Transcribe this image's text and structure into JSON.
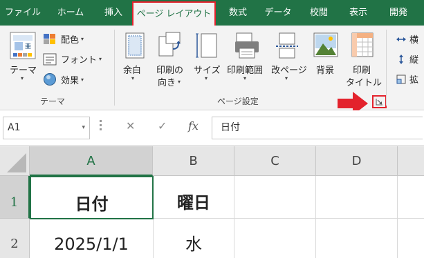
{
  "tabs": [
    {
      "label": "ファイル",
      "active": false
    },
    {
      "label": "ホーム",
      "active": false
    },
    {
      "label": "挿入",
      "active": false
    },
    {
      "label": "ページ レイアウト",
      "active": true
    },
    {
      "label": "数式",
      "active": false
    },
    {
      "label": "データ",
      "active": false
    },
    {
      "label": "校閲",
      "active": false
    },
    {
      "label": "表示",
      "active": false
    },
    {
      "label": "開発",
      "active": false
    }
  ],
  "ribbon": {
    "theme_group": {
      "theme_label": "テーマ",
      "colors_label": "配色",
      "fonts_label": "フォント",
      "effects_label": "効果",
      "group_label": "テーマ"
    },
    "page_setup_group": {
      "margins_label": "余白",
      "orientation_label_1": "印刷の",
      "orientation_label_2": "向き",
      "size_label": "サイズ",
      "print_area_label": "印刷範囲",
      "breaks_label": "改ページ",
      "background_label": "背景",
      "print_titles_label_1": "印刷",
      "print_titles_label_2": "タイトル",
      "group_label": "ページ設定"
    },
    "scale_group": {
      "width_label": "横",
      "height_label": "縦",
      "scale_label": "拡"
    }
  },
  "formula_bar": {
    "name_box": "A1",
    "cancel_symbol": "✕",
    "enter_symbol": "✓",
    "function_symbol": "fx",
    "content": "日付"
  },
  "grid": {
    "columns": [
      "A",
      "B",
      "C",
      "D"
    ],
    "rows": [
      {
        "number": "1",
        "cells": [
          "日付",
          "曜日",
          "",
          ""
        ]
      },
      {
        "number": "2",
        "cells": [
          "2025/1/1",
          "水",
          "",
          ""
        ]
      }
    ]
  },
  "colors": {
    "accent": "#217346",
    "highlight": "#e3222c"
  }
}
